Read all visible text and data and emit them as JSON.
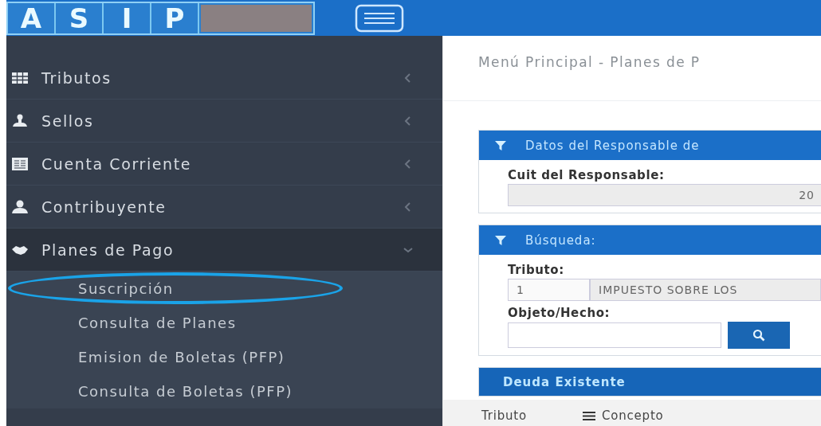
{
  "header": {
    "logo_letters": [
      "A",
      "S",
      "I",
      "P"
    ]
  },
  "sidebar": {
    "items": [
      {
        "label": "Tributos",
        "expanded": false
      },
      {
        "label": "Sellos",
        "expanded": false
      },
      {
        "label": "Cuenta Corriente",
        "expanded": false
      },
      {
        "label": "Contribuyente",
        "expanded": false
      },
      {
        "label": "Planes de Pago",
        "expanded": true,
        "children": [
          {
            "label": "Suscripción",
            "circled": true
          },
          {
            "label": "Consulta de Planes",
            "circled": false
          },
          {
            "label": "Emision de Boletas (PFP)",
            "circled": false
          },
          {
            "label": "Consulta de Boletas (PFP)",
            "circled": false
          }
        ]
      }
    ]
  },
  "breadcrumb": "Menú Principal - Planes de P",
  "panels": [
    {
      "kind": "form",
      "title": "Datos del Responsable de",
      "fields": [
        {
          "kind": "readonly",
          "label": "Cuit del Responsable:",
          "values": [
            "20"
          ]
        }
      ]
    },
    {
      "kind": "form",
      "title": "Búsqueda:",
      "fields": [
        {
          "kind": "code_pair",
          "label": "Tributo:",
          "values": [
            "1",
            "IMPUESTO SOBRE LOS"
          ]
        },
        {
          "kind": "search",
          "label": "Objeto/Hecho:"
        }
      ]
    },
    {
      "kind": "table",
      "title": "Deuda Existente",
      "columns": [
        {
          "kind": "plain",
          "label": "Tributo"
        },
        {
          "kind": "menu",
          "label": "Concepto"
        }
      ]
    }
  ]
}
